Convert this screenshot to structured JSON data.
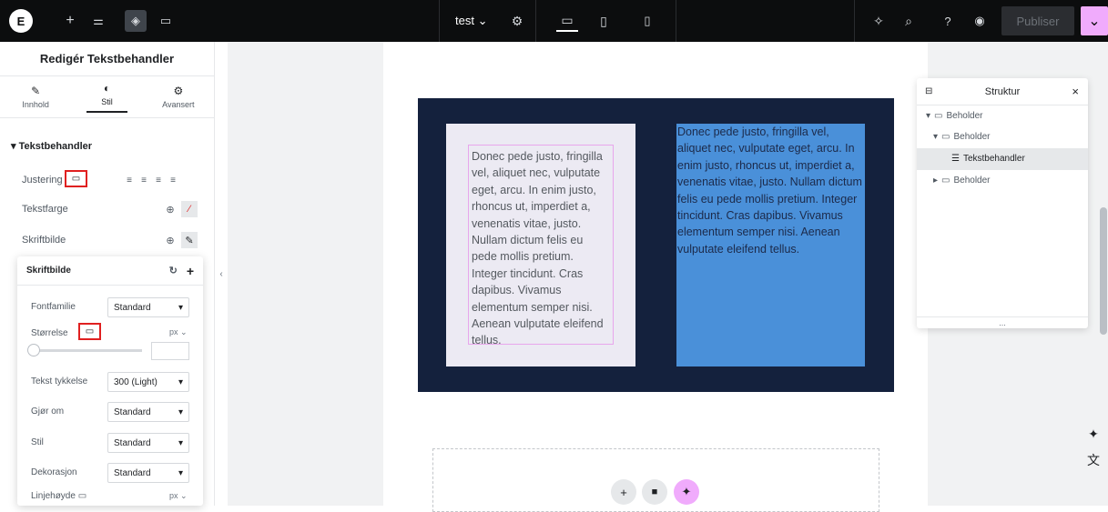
{
  "topbar": {
    "logo": "E",
    "page_name": "test",
    "page_dropdown": "⌄",
    "publish_label": "Publiser"
  },
  "panel": {
    "title": "Redigér Tekstbehandler",
    "tabs": [
      {
        "label": "Innhold",
        "icon": "pencil-icon"
      },
      {
        "label": "Stil",
        "icon": "half-circle-icon"
      },
      {
        "label": "Avansert",
        "icon": "gear-icon"
      }
    ],
    "section_title": "Tekstbehandler",
    "controls": {
      "alignment": "Justering",
      "text_color": "Tekstfarge",
      "typography": "Skriftbilde"
    }
  },
  "typography_popover": {
    "title": "Skriftbilde",
    "font_family_label": "Fontfamilie",
    "font_family_value": "Standard",
    "size_label": "Størrelse",
    "size_unit": "px",
    "size_slider_value": 0,
    "weight_label": "Tekst tykkelse",
    "weight_value": "300 (Light)",
    "transform_label": "Gjør om",
    "transform_value": "Standard",
    "style_label": "Stil",
    "style_value": "Standard",
    "decoration_label": "Dekorasjon",
    "decoration_value": "Standard",
    "line_height_label": "Linjehøyde",
    "line_height_unit": "px"
  },
  "canvas": {
    "text_left": "Donec pede justo, fringilla vel, aliquet nec, vulputate eget, arcu. In enim justo, rhoncus ut, imperdiet a, venenatis vitae, justo. Nullam dictum felis eu pede mollis pretium. Integer tincidunt. Cras dapibus. Vivamus elementum semper nisi. Aenean vulputate eleifend tellus.",
    "text_right": "Donec pede justo, fringilla vel, aliquet nec, vulputate eget, arcu. In enim justo, rhoncus ut, imperdiet a, venenatis vitae, justo. Nullam dictum felis eu pede mollis pretium. Integer tincidunt. Cras dapibus. Vivamus elementum semper nisi. Aenean vulputate eleifend tellus."
  },
  "structure": {
    "title": "Struktur",
    "items": [
      {
        "label": "Beholder",
        "level": 0,
        "expanded": true
      },
      {
        "label": "Beholder",
        "level": 1,
        "expanded": true
      },
      {
        "label": "Tekstbehandler",
        "level": 2,
        "selected": true
      },
      {
        "label": "Beholder",
        "level": 1,
        "expanded": false
      }
    ],
    "footer": "..."
  },
  "colors": {
    "accent": "#f0abfc",
    "dark_section": "#14213d",
    "blue_card": "#4a90d9",
    "highlight_red": "#e02020"
  }
}
